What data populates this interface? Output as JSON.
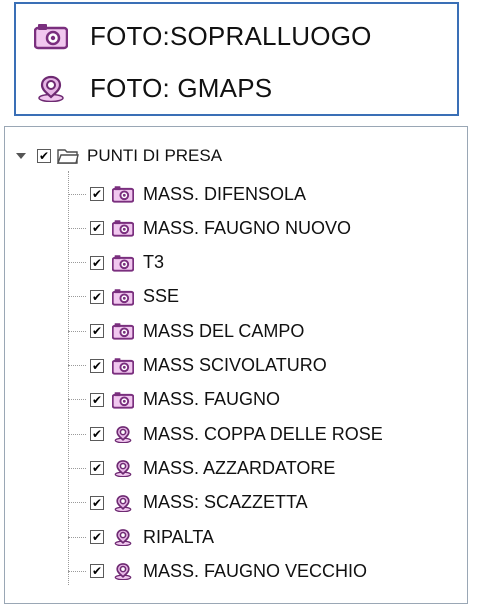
{
  "legend": {
    "items": [
      {
        "label": "FOTO:SOPRALLUOGO",
        "icon": "camera-icon"
      },
      {
        "label": "FOTO: GMAPS",
        "icon": "gmaps-marker-icon"
      }
    ]
  },
  "tree": {
    "root": {
      "label": "PUNTI DI PRESA",
      "checked": true,
      "expanded": true,
      "icon": "folder-open-icon"
    },
    "children": [
      {
        "label": "MASS. DIFENSOLA",
        "icon": "camera-icon",
        "checked": true
      },
      {
        "label": "MASS. FAUGNO NUOVO",
        "icon": "camera-icon",
        "checked": true
      },
      {
        "label": "T3",
        "icon": "camera-icon",
        "checked": true
      },
      {
        "label": "SSE",
        "icon": "camera-icon",
        "checked": true
      },
      {
        "label": "MASS DEL CAMPO",
        "icon": "camera-icon",
        "checked": true
      },
      {
        "label": "MASS SCIVOLATURO",
        "icon": "camera-icon",
        "checked": true
      },
      {
        "label": "MASS. FAUGNO",
        "icon": "camera-icon",
        "checked": true
      },
      {
        "label": "MASS. COPPA DELLE ROSE",
        "icon": "gmaps-marker-icon",
        "checked": true
      },
      {
        "label": "MASS. AZZARDATORE",
        "icon": "gmaps-marker-icon",
        "checked": true
      },
      {
        "label": "MASS: SCAZZETTA",
        "icon": "gmaps-marker-icon",
        "checked": true
      },
      {
        "label": "RIPALTA",
        "icon": "gmaps-marker-icon",
        "checked": true
      },
      {
        "label": "MASS. FAUGNO VECCHIO",
        "icon": "gmaps-marker-icon",
        "checked": true
      }
    ]
  },
  "colors": {
    "camera_purple": "#7a2f7e",
    "camera_pink": "#f1c7ef",
    "marker_purple": "#6e2a72",
    "frame_blue": "#3a6fb6"
  }
}
